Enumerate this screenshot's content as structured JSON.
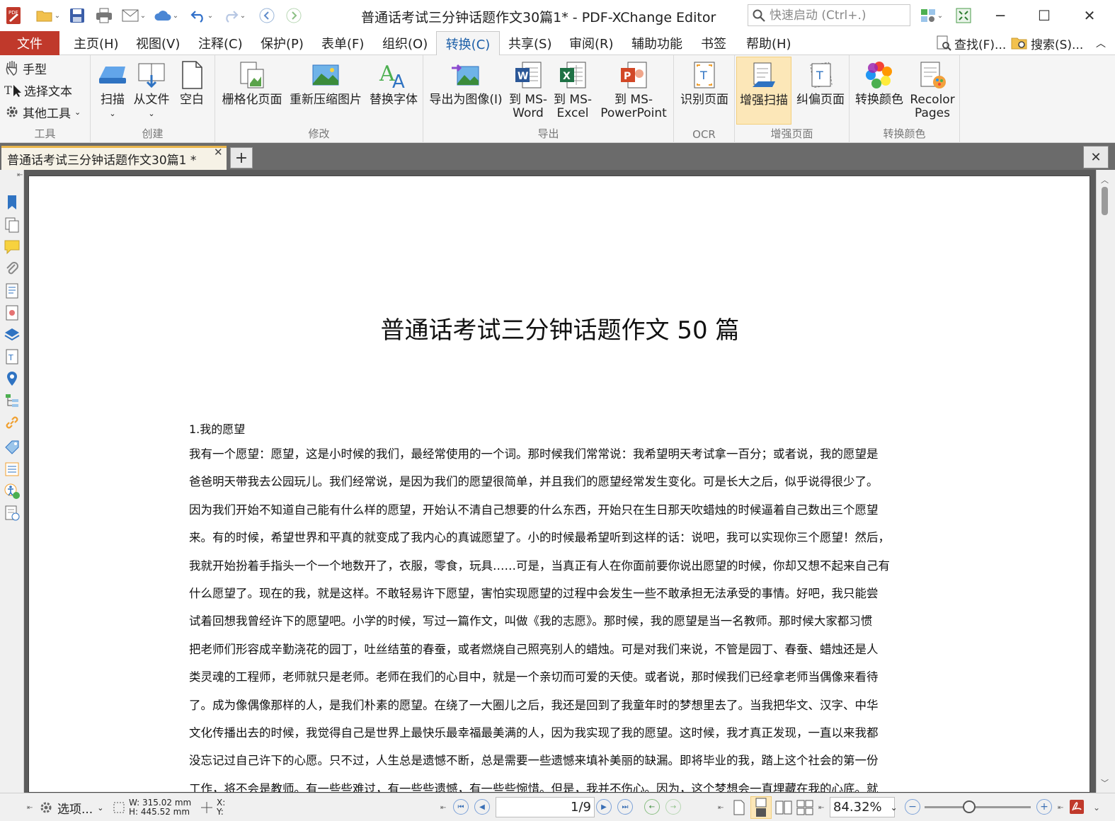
{
  "window": {
    "title": "普通话考试三分钟话题作文30篇1* - PDF-XChange Editor",
    "quick_launch_placeholder": "快速启动 (Ctrl+.)"
  },
  "menu": {
    "file": "文件",
    "tabs": [
      "主页(H)",
      "视图(V)",
      "注释(C)",
      "保护(P)",
      "表单(F)",
      "组织(O)",
      "转换(C)",
      "共享(S)",
      "审阅(R)",
      "辅助功能",
      "书签",
      "帮助(H)"
    ],
    "active_tab": "转换(C)",
    "find": "查找(F)...",
    "search": "搜索(S)..."
  },
  "ribbon": {
    "tools": {
      "label": "工具",
      "hand": "手型",
      "select_text": "选择文本",
      "other_tools": "其他工具"
    },
    "create": {
      "label": "创建",
      "scan": "扫描",
      "from_file": "从文件",
      "blank": "空白"
    },
    "modify": {
      "label": "修改",
      "rasterize": "栅格化页面",
      "recompress": "重新压缩图片",
      "replace_fonts": "替换字体"
    },
    "export": {
      "label": "导出",
      "to_image": "导出为图像(I)",
      "to_word_1": "到 MS-",
      "to_word_2": "Word",
      "to_excel_1": "到 MS-",
      "to_excel_2": "Excel",
      "to_ppt_1": "到 MS-",
      "to_ppt_2": "PowerPoint"
    },
    "ocr": {
      "label": "OCR",
      "recognize": "识别页面"
    },
    "enhance": {
      "label": "增强页面",
      "enhance_scan": "增强扫描",
      "deskew": "纠偏页面"
    },
    "recolor": {
      "label": "转换颜色",
      "convert_colors": "转换颜色",
      "recolor_1": "Recolor",
      "recolor_2": "Pages"
    }
  },
  "doc_tab": {
    "title": "普通话考试三分钟话题作文30篇1 *"
  },
  "document": {
    "title": "普通话考试三分钟话题作文 50 篇",
    "heading": "1.我的愿望",
    "lines": [
      "我有一个愿望：愿望，这是小时候的我们，最经常使用的一个词。那时候我们常常说：我希望明天考试拿一百分；或者说，我的愿望是",
      "爸爸明天带我去公园玩儿。我们经常说，是因为我们的愿望很简单，并且我们的愿望经常发生变化。可是长大之后，似乎说得很少了。",
      "因为我们开始不知道自己能有什么样的愿望，开始认不清自己想要的什么东西，开始只在生日那天吹蜡烛的时候逼着自己数出三个愿望",
      "来。有的时候，希望世界和平真的就变成了我内心的真诚愿望了。小的时候最希望听到这样的话：说吧，我可以实现你三个愿望！然后，",
      "我就开始扮着手指头一个一个地数开了，衣服，零食，玩具……可是，当真正有人在你面前要你说出愿望的时候，你却又想不起来自己有",
      "什么愿望了。现在的我，就是这样。不敢轻易许下愿望，害怕实现愿望的过程中会发生一些不敢承担无法承受的事情。好吧，我只能尝",
      "试着回想我曾经许下的愿望吧。小学的时候，写过一篇作文，叫做《我的志愿》。那时候，我的愿望是当一名教师。那时候大家都习惯",
      "把老师们形容成辛勤浇花的园丁，吐丝结茧的春蚕，或者燃烧自己照亮别人的蜡烛。可是对我们来说，不管是园丁、春蚕、蜡烛还是人",
      "类灵魂的工程师，老师就只是老师。老师在我们的心目中，就是一个亲切而可爱的天使。或者说，那时候我们已经拿老师当偶像来看待",
      "了。成为像偶像那样的人，是我们朴素的愿望。在绕了一大圈儿之后，我还是回到了我童年时的梦想里去了。当我把华文、汉字、中华",
      "文化传播出去的时候，我觉得自己是世界上最快乐最幸福最美满的人，因为我实现了我的愿望。这时候，我才真正发现，一直以来我都",
      "没忘记过自己许下的心愿。只不过，人生总是遗憾不断，总是需要一些遗憾来填补美丽的缺漏。即将毕业的我，踏上这个社会的第一份",
      "工作，将不会是教师。有一些些难过，有一些些遗憾，有一些些惋惜。但是，我并不伤心。因为，这个梦想会一直埋藏在我的心底。就"
    ]
  },
  "status": {
    "options": "选项...",
    "width": "W: 315.02 mm",
    "height": "H: 445.52 mm",
    "x": "X:",
    "y": "Y:",
    "current_page": "1",
    "total_pages": "/9",
    "zoom": "84.32%",
    "zoom_level": 0.42
  },
  "colors": {
    "file_tab": "#c0392b",
    "active_ribbon": "#fce7b8",
    "accent": "#1c5fa8"
  }
}
